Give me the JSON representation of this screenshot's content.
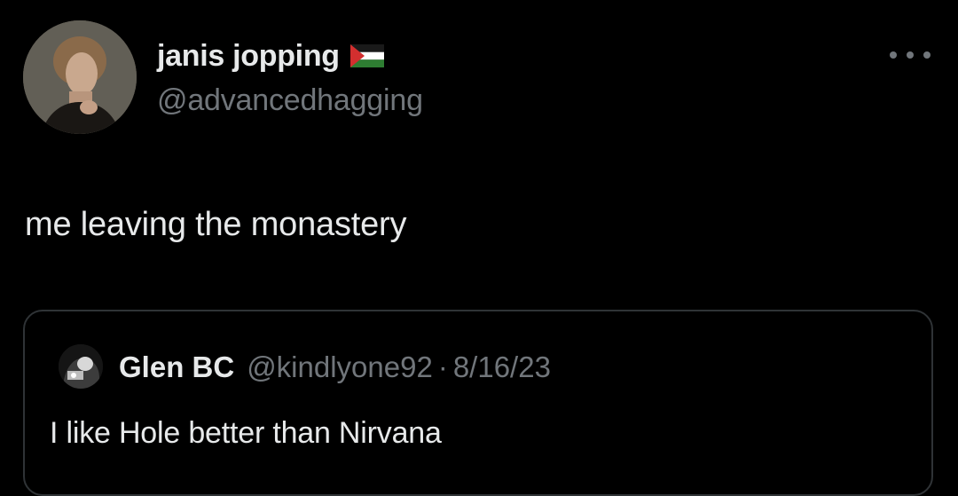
{
  "post": {
    "author": {
      "display_name": "janis jopping",
      "flag_icon": "palestine-flag-icon",
      "handle": "@advancedhagging"
    },
    "text": "me leaving the monastery",
    "more_icon": "more-options-icon"
  },
  "quoted_post": {
    "author": {
      "display_name": "Glen BC",
      "handle": "@kindlyone92"
    },
    "separator": "·",
    "date": "8/16/23",
    "text": "I like Hole better than Nirvana"
  },
  "colors": {
    "background": "#000000",
    "primary_text": "#e7e9ea",
    "secondary_text": "#71767b",
    "border": "#2f3336"
  }
}
